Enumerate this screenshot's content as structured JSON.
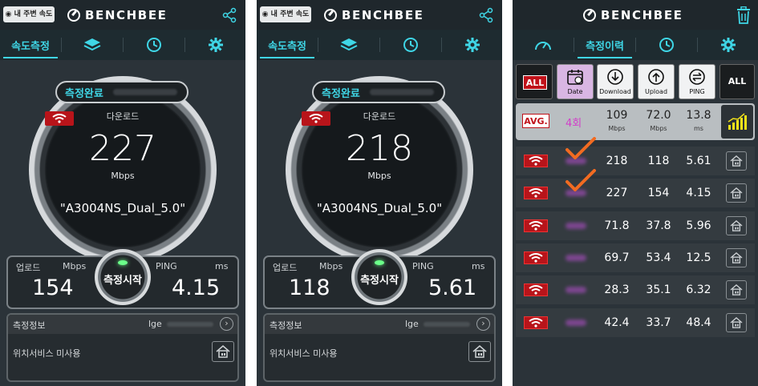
{
  "brand": {
    "name": "BENCHBEE",
    "accent": "#3fd6e6",
    "red": "#b8141a"
  },
  "header": {
    "nearby_label": "내 주변 속도"
  },
  "tabs": {
    "speed_test": "속도측정",
    "history": "측정이력"
  },
  "screens": [
    {
      "status": "측정완료",
      "download_label": "다운로드",
      "download_speed": "227",
      "unit": "Mbps",
      "ssid": "\"A3004NS_Dual_5.0\"",
      "upload_label": "업로드",
      "upload_unit": "Mbps",
      "upload_value": "154",
      "ping_label": "PING",
      "ping_unit": "ms",
      "ping_value": "4.15",
      "start_label": "측정시작",
      "info_title": "측정정보",
      "isp": "lge",
      "location": "위치서비스 미사용"
    },
    {
      "status": "측정완료",
      "download_label": "다운로드",
      "download_speed": "218",
      "unit": "Mbps",
      "ssid": "\"A3004NS_Dual_5.0\"",
      "upload_label": "업로드",
      "upload_unit": "Mbps",
      "upload_value": "118",
      "ping_label": "PING",
      "ping_unit": "ms",
      "ping_value": "5.61",
      "start_label": "측정시작",
      "info_title": "측정정보",
      "isp": "lge",
      "location": "위치서비스 미사용"
    }
  ],
  "history": {
    "filters": {
      "all_left": "ALL",
      "date": "Date",
      "download": "Download",
      "upload": "Upload",
      "ping": "PING",
      "all_right": "ALL"
    },
    "average": {
      "badge": "AVG.",
      "count": "4회",
      "download": "109",
      "download_unit": "Mbps",
      "upload": "72.0",
      "upload_unit": "Mbps",
      "ping": "13.8",
      "ping_unit": "ms"
    },
    "rows": [
      {
        "download": "218",
        "upload": "118",
        "ping": "5.61",
        "checked": true
      },
      {
        "download": "227",
        "upload": "154",
        "ping": "4.15",
        "checked": true
      },
      {
        "download": "71.8",
        "upload": "37.8",
        "ping": "5.96",
        "checked": false
      },
      {
        "download": "69.7",
        "upload": "53.4",
        "ping": "12.5",
        "checked": false
      },
      {
        "download": "28.3",
        "upload": "35.1",
        "ping": "6.32",
        "checked": false
      },
      {
        "download": "42.4",
        "upload": "33.7",
        "ping": "48.4",
        "checked": false
      }
    ]
  }
}
